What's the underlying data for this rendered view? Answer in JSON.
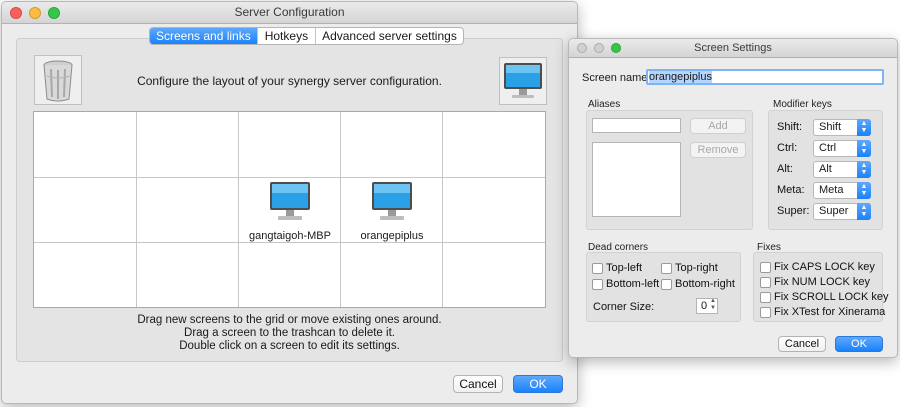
{
  "server_window": {
    "title": "Server Configuration",
    "tabs": [
      {
        "label": "Screens and links",
        "active": true
      },
      {
        "label": "Hotkeys",
        "active": false
      },
      {
        "label": "Advanced server settings",
        "active": false
      }
    ],
    "description": "Configure the layout of your synergy server configuration.",
    "screens": [
      {
        "name": "gangtaigoh-MBP"
      },
      {
        "name": "orangepiplus"
      }
    ],
    "hints": [
      "Drag new screens to the grid or move existing ones around.",
      "Drag a screen to the trashcan to delete it.",
      "Double click on a screen to edit its settings."
    ],
    "cancel_label": "Cancel",
    "ok_label": "OK"
  },
  "screen_settings": {
    "title": "Screen Settings",
    "screen_name_label": "Screen name:",
    "screen_name_value": "orangepiplus",
    "aliases": {
      "label": "Aliases",
      "input_value": "",
      "add_label": "Add",
      "remove_label": "Remove"
    },
    "modifier_keys": {
      "label": "Modifier keys",
      "rows": [
        {
          "label": "Shift:",
          "value": "Shift"
        },
        {
          "label": "Ctrl:",
          "value": "Ctrl"
        },
        {
          "label": "Alt:",
          "value": "Alt"
        },
        {
          "label": "Meta:",
          "value": "Meta"
        },
        {
          "label": "Super:",
          "value": "Super"
        }
      ]
    },
    "dead_corners": {
      "label": "Dead corners",
      "top_left": "Top-left",
      "top_right": "Top-right",
      "bottom_left": "Bottom-left",
      "bottom_right": "Bottom-right",
      "corner_size_label": "Corner Size:",
      "corner_size_value": "0"
    },
    "fixes": {
      "label": "Fixes",
      "items": [
        "Fix CAPS LOCK key",
        "Fix NUM LOCK key",
        "Fix SCROLL LOCK key",
        "Fix XTest for Xinerama"
      ]
    },
    "cancel_label": "Cancel",
    "ok_label": "OK"
  },
  "colors": {
    "accent": "#1a82fb",
    "close": "#fc605c",
    "minimize": "#fdbc40",
    "zoom": "#34c84a",
    "inactive_light": "#d0d0d0"
  },
  "icons": [
    "trash-icon",
    "monitor-icon"
  ]
}
